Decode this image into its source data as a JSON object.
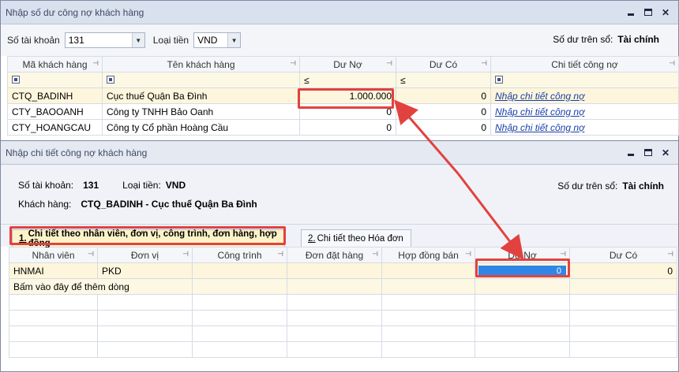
{
  "main_window": {
    "title": "Nhập số dư công nợ khách hàng",
    "account_label": "Số tài khoản",
    "account_value": "131",
    "currency_label": "Loại tiền",
    "currency_value": "VND",
    "balance_label": "Số dư trên sổ:",
    "balance_value": "Tài chính",
    "columns": [
      "Mã khách hàng",
      "Tên khách hàng",
      "Dư Nợ",
      "Dư Có",
      "Chi tiết công nợ"
    ],
    "filter_ops": [
      "≤",
      "≤"
    ],
    "rows": [
      {
        "code": "CTQ_BADINH",
        "name": "Cục thuế Quận Ba Đình",
        "debit": "1.000.000",
        "credit": "0",
        "detail": "Nhập chi tiết công nợ"
      },
      {
        "code": "CTY_BAOOANH",
        "name": "Công ty TNHH Bảo Oanh",
        "debit": "0",
        "credit": "0",
        "detail": "Nhập chi tiết công nợ"
      },
      {
        "code": "CTY_HOANGCAU",
        "name": "Công ty Cổ phần Hoàng Cầu",
        "debit": "0",
        "credit": "0",
        "detail": "Nhập chi tiết công nợ"
      }
    ]
  },
  "detail_window": {
    "title": "Nhập chi tiết công nợ khách hàng",
    "account_label": "Số tài khoản:",
    "account_value": "131",
    "currency_label": "Loại tiền:",
    "currency_value": "VND",
    "balance_label": "Số dư trên sổ:",
    "balance_value": "Tài chính",
    "customer_label": "Khách hàng:",
    "customer_value": "CTQ_BADINH - Cục thuế Quận Ba Đình",
    "tabs": [
      {
        "num": "1.",
        "label": "Chi tiết theo nhân viên, đơn vị, công trình, đơn hàng, hợp đồng"
      },
      {
        "num": "2.",
        "label": "Chi tiết theo Hóa đơn"
      }
    ],
    "columns": [
      "Nhân viên",
      "Đơn vị",
      "Công trình",
      "Đơn đặt hàng",
      "Hợp đồng bán",
      "Dư Nợ",
      "Dư Có"
    ],
    "row": {
      "employee": "HNMAI",
      "unit": "PKD",
      "debit": "0",
      "credit": "0"
    },
    "add_row_hint": "Bấm vào đây để thêm dòng"
  },
  "colors": {
    "highlight": "#e2423f",
    "editor": "#2f86e6",
    "selected_row": "#fdf6dc"
  },
  "icons": [
    "dropdown-arrow-icon",
    "pin-icon",
    "minimize-icon",
    "maximize-icon",
    "close-icon",
    "filter-checkbox-icon",
    "arrow-connector"
  ]
}
